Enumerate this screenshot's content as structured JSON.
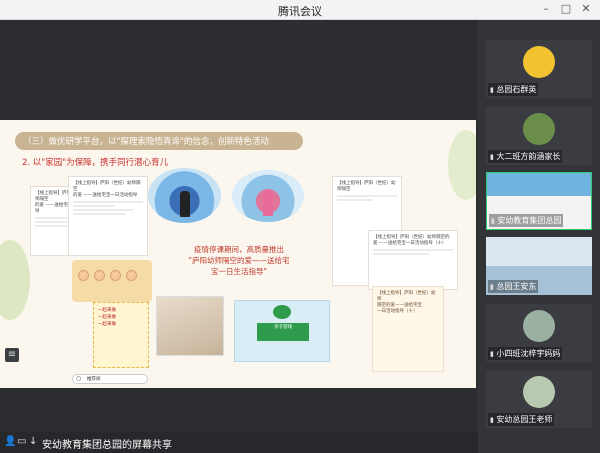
{
  "window": {
    "title": "腾讯会议"
  },
  "slide": {
    "banner": "（三）做优研学平台，以\"探理索隐悟真谛\"的信念，创新特色活动",
    "subtitle": "2. 以\"家园\"为保障，携手同行潜心育儿",
    "quote_line1": "疫情停课期间，高质量推出",
    "quote_line2": "\"庐阳幼师隔空的爱——送给宅",
    "quote_line3": "宝一日生活指导\"",
    "doc_left_1": "【线上指导】庐阳（世纪）幼师隔空",
    "doc_left_2": "的爱 ——送给宅宝一日活动指导",
    "doc_right_1": "【线上指导】庐阳（世纪）幼师隔空的",
    "doc_right_2": "爱 ——送给宅宝一日活动指导（十）",
    "doc2_1": "【线上指导】庐阳（世纪）幼师",
    "doc2_2": "隔空的爱——送给宅宝",
    "doc2_3": "一日活动指导（十）",
    "card4_tag": "亲子游戏",
    "search_text": "推荐阅",
    "panel_text": "一起来做"
  },
  "share": {
    "label": "安幼教育集团总园的屏幕共享"
  },
  "participants": [
    {
      "name": "总园石群英",
      "av": "#f2c230"
    },
    {
      "name": "大二班方韵涵家长",
      "av": "#6b8f4a"
    },
    {
      "name": "安幼教育集团总园",
      "av": "#2e7bbd"
    },
    {
      "name": "总园王安东",
      "av": "#88a9c8"
    },
    {
      "name": "小四班沈梓宇妈妈",
      "av": "#9ab0a0"
    },
    {
      "name": "安幼总园王老师",
      "av": "#b9c8b0"
    }
  ]
}
